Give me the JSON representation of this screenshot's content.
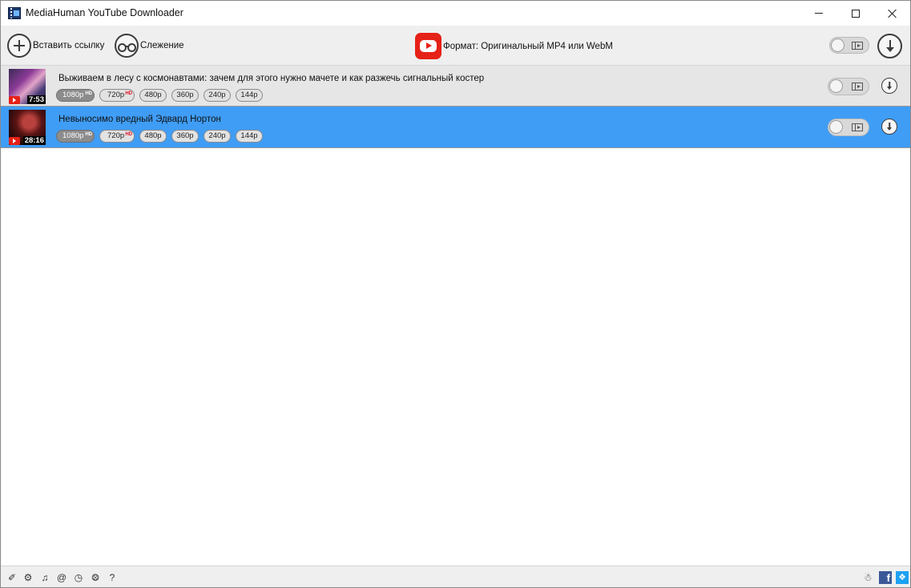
{
  "window": {
    "title": "MediaHuman YouTube Downloader"
  },
  "toolbar": {
    "paste_label": "Вставить ссылку",
    "tracking_label": "Слежение",
    "format_label": "Формат: Оригинальный MP4 или WebM"
  },
  "items": [
    {
      "title": "Выживаем в лесу с космонавтами: зачем для этого нужно мачете и как разжечь сигнальный костер",
      "duration": "7:53",
      "qualities": [
        {
          "label": "1080p",
          "badge": "HD",
          "selected": true
        },
        {
          "label": "720p",
          "badge": "HD",
          "selected": false
        },
        {
          "label": "480p",
          "badge": "",
          "selected": false
        },
        {
          "label": "360p",
          "badge": "",
          "selected": false
        },
        {
          "label": "240p",
          "badge": "",
          "selected": false
        },
        {
          "label": "144p",
          "badge": "",
          "selected": false
        }
      ]
    },
    {
      "title": "Невыносимо вредный Эдвард Нортон",
      "duration": "28:16",
      "qualities": [
        {
          "label": "1080p",
          "badge": "HD",
          "selected": true
        },
        {
          "label": "720p",
          "badge": "HD",
          "selected": false
        },
        {
          "label": "480p",
          "badge": "",
          "selected": false
        },
        {
          "label": "360p",
          "badge": "",
          "selected": false
        },
        {
          "label": "240p",
          "badge": "",
          "selected": false
        },
        {
          "label": "144p",
          "badge": "",
          "selected": false
        }
      ]
    }
  ],
  "statusbar": {
    "icons": [
      "broom-icon",
      "gear-icon",
      "music-note-icon",
      "snail-icon",
      "clock-icon",
      "binoculars-icon",
      "help-icon"
    ],
    "help_glyph": "?"
  },
  "colors": {
    "selected_row": "#3f9df6",
    "row_bg": "#e6e6e6",
    "youtube_red": "#e62117",
    "facebook": "#3b5998",
    "twitter": "#1da1f2"
  }
}
